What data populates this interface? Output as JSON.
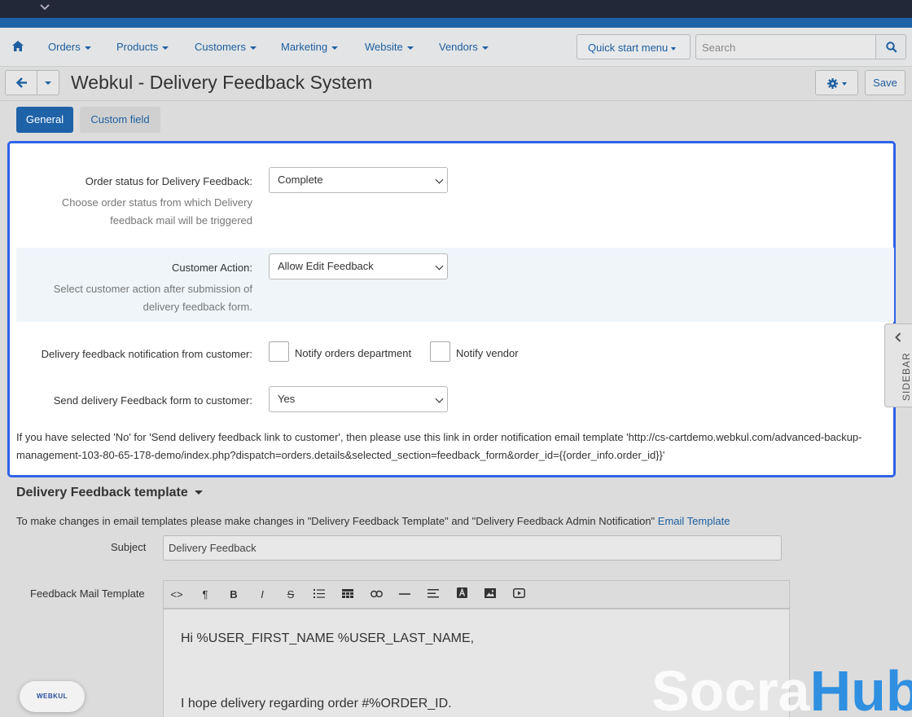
{
  "topstrip": {
    "chevron_icon": "chevron-down-icon"
  },
  "nav": {
    "home_icon": "home-icon",
    "items": [
      "Orders",
      "Products",
      "Customers",
      "Marketing",
      "Website",
      "Vendors"
    ],
    "quick_start": "Quick start menu",
    "search_placeholder": "Search",
    "search_icon": "search-icon"
  },
  "header": {
    "title": "Webkul - Delivery Feedback System",
    "save_label": "Save",
    "gear_icon": "gear-icon",
    "back_icon": "arrow-left-icon"
  },
  "tabs": [
    {
      "label": "General",
      "active": true
    },
    {
      "label": "Custom field",
      "active": false
    }
  ],
  "settings": {
    "order_status": {
      "label": "Order status for Delivery Feedback:",
      "value": "Complete",
      "hint_line1": "Choose order status from which Delivery",
      "hint_line2": "feedback mail will be triggered"
    },
    "customer_action": {
      "label": "Customer Action:",
      "value": "Allow Edit Feedback",
      "hint_line1": "Select customer action after submission of",
      "hint_line2": "delivery feedback form."
    },
    "notification": {
      "label": "Delivery feedback notification from customer:",
      "option1": "Notify orders department",
      "option2": "Notify vendor"
    },
    "send_form": {
      "label": "Send delivery Feedback form to customer:",
      "value": "Yes"
    },
    "note_line1": "If you have selected 'No' for 'Send delivery feedback link to customer', then please use this link in order notification email template 'http://cs-cartdemo.webkul.com/advanced-backup-",
    "note_line2": "management-103-80-65-178-demo/index.php?dispatch=orders.details&selected_section=feedback_form&order_id={{order_info.order_id}}'"
  },
  "sidebar": {
    "label": "SIDEBAR",
    "icon": "chevron-left-icon"
  },
  "template": {
    "heading": "Delivery Feedback template",
    "desc": "To make changes in email templates please make changes in \"Delivery Feedback Template\" and \"Delivery Feedback Admin Notification\"",
    "desc_link": "Email Template",
    "subject_label": "Subject",
    "subject_value": "Delivery Feedback",
    "mail_label": "Feedback Mail Template",
    "toolbar": {
      "code": "<>",
      "paragraph": "¶",
      "bold": "B",
      "italic": "I",
      "strike": "S"
    },
    "body_line1": "Hi %USER_FIRST_NAME %USER_LAST_NAME,",
    "body_line2": "I hope delivery regarding order #%ORDER_ID."
  },
  "badge": {
    "text": "WEBKUL"
  },
  "watermark": {
    "part1": "Socra",
    "part2": "Hub"
  }
}
